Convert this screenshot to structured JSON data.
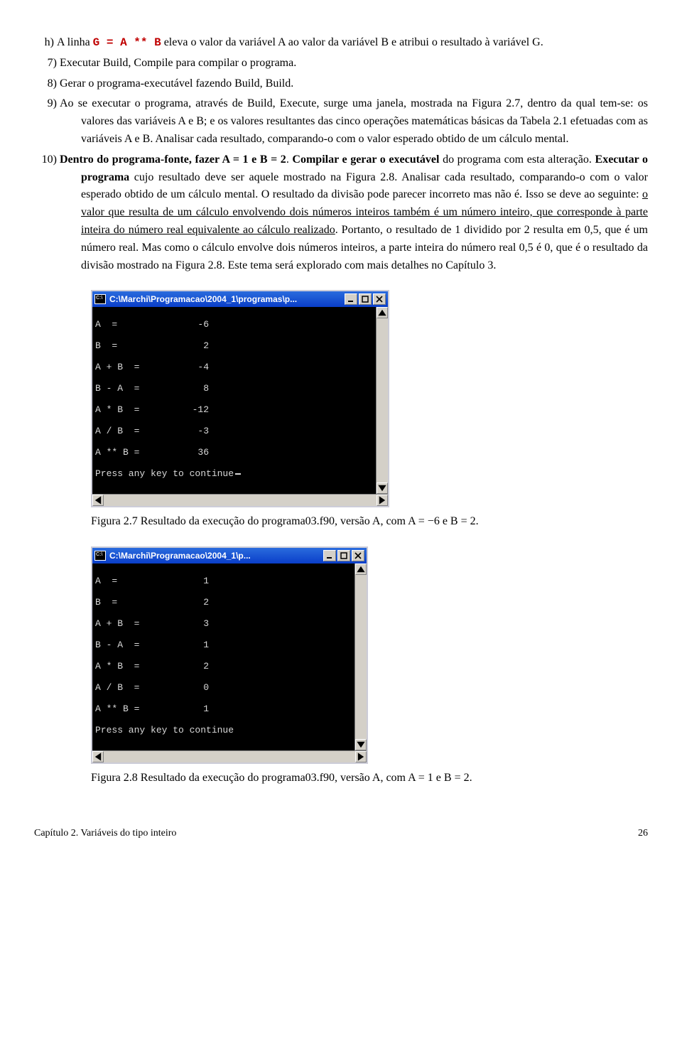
{
  "items": {
    "h": {
      "num": "h)",
      "pre": "A linha ",
      "code": "G = A ** B",
      "post": " eleva o valor da variável A ao valor da variável B e atribui o resultado à variável G."
    },
    "i7": {
      "num": "7)",
      "text": "Executar Build, Compile para compilar o programa."
    },
    "i8": {
      "num": "8)",
      "text": "Gerar o programa-executável fazendo Build, Build."
    },
    "i9": {
      "num": "9)",
      "text": "Ao se executar o programa, através de Build, Execute, surge uma janela, mostrada na Figura 2.7, dentro da qual tem-se: os valores das variáveis A e B; e os valores resultantes das cinco operações matemáticas básicas da Tabela 2.1 efetuadas com as variáveis A e B. Analisar cada resultado, comparando-o com o valor esperado obtido de um cálculo mental."
    },
    "i10": {
      "num": "10)",
      "p1": "Dentro do programa-fonte, fazer A = 1 e B = 2",
      "p2": ". ",
      "p3": "Compilar e gerar o executável",
      "p4": " do programa com esta alteração. ",
      "p5": "Executar o programa",
      "p6": " cujo resultado deve ser aquele mostrado na Figura 2.8. Analisar cada resultado, comparando-o com o valor esperado obtido de um cálculo mental. O resultado da divisão pode parecer incorreto mas não é. Isso se deve ao seguinte: ",
      "u1": "o valor que resulta de um cálculo envolvendo dois números inteiros também é um número inteiro, que corresponde à parte inteira do número real equivalente ao cálculo realizado",
      "p7": ". Portanto, o resultado de 1 dividido por 2 resulta em 0,5, que é um número real. Mas como o cálculo envolve dois números inteiros, a parte inteira do número real 0,5 é 0, que é o resultado da divisão mostrado na Figura 2.8. Este tema será explorado com mais detalhes no Capítulo 3."
    }
  },
  "console1": {
    "title": "C:\\Marchi\\Programacao\\2004_1\\programas\\p...",
    "ticon": "C:\\",
    "rows": [
      {
        "label": "A  =",
        "value": "-6"
      },
      {
        "label": "B  =",
        "value": "2"
      },
      {
        "label": "A + B  =",
        "value": "-4"
      },
      {
        "label": "B - A  =",
        "value": "8"
      },
      {
        "label": "A * B  =",
        "value": "-12"
      },
      {
        "label": "A / B  =",
        "value": "-3"
      },
      {
        "label": "A ** B =",
        "value": "36"
      }
    ],
    "press": "Press any key to continue"
  },
  "caption1": "Figura 2.7 Resultado da execução do programa03.f90, versão A, com A = −6 e B = 2.",
  "console2": {
    "title": "C:\\Marchi\\Programacao\\2004_1\\p...",
    "ticon": "C:\\",
    "rows": [
      {
        "label": "A  =",
        "value": "1"
      },
      {
        "label": "B  =",
        "value": "2"
      },
      {
        "label": "A + B  =",
        "value": "3"
      },
      {
        "label": "B - A  =",
        "value": "1"
      },
      {
        "label": "A * B  =",
        "value": "2"
      },
      {
        "label": "A / B  =",
        "value": "0"
      },
      {
        "label": "A ** B =",
        "value": "1"
      }
    ],
    "press": "Press any key to continue"
  },
  "caption2": "Figura 2.8 Resultado da execução do programa03.f90, versão A, com A = 1 e B = 2.",
  "footer": {
    "left": "Capítulo 2. Variáveis do tipo inteiro",
    "right": "26"
  }
}
